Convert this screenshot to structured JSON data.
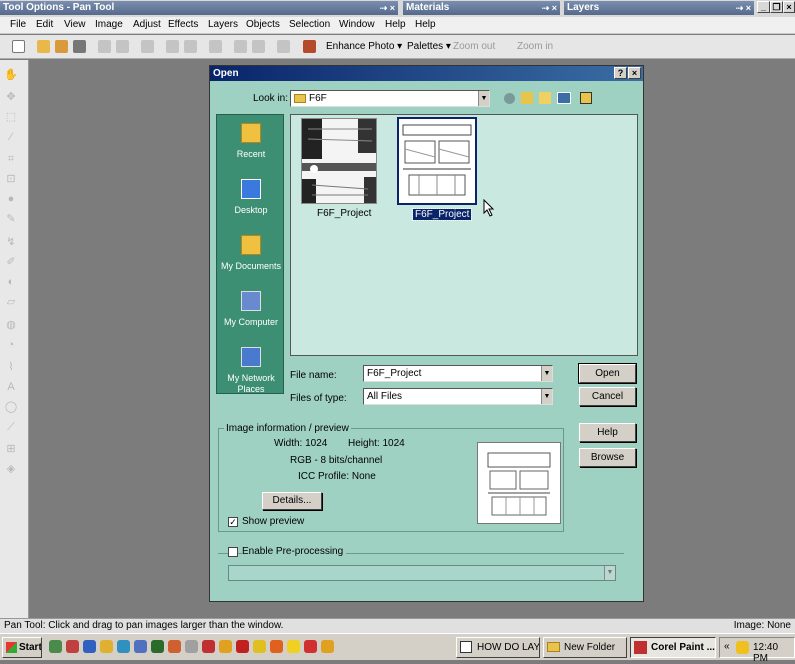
{
  "palettes": {
    "tool_options": "Tool Options - Pan Tool",
    "materials": "Materials",
    "layers": "Layers",
    "pin_close": "⇢ ×"
  },
  "menu": [
    "File",
    "Edit",
    "View",
    "Image",
    "Adjust",
    "Effects",
    "Layers",
    "Objects",
    "Selection",
    "Window",
    "Help",
    "Help"
  ],
  "toolbar": {
    "enhance_photo": "Enhance Photo ▾",
    "palettes": "Palettes ▾",
    "zoom_out": "Zoom out",
    "zoom_in": "Zoom in"
  },
  "dialog": {
    "title": "Open",
    "help_btn": "?",
    "close_btn": "×",
    "look_in_label": "Look in:",
    "look_in_value": "F6F",
    "places": [
      "Recent",
      "Desktop",
      "My Documents",
      "My Computer",
      "My Network Places"
    ],
    "files": [
      {
        "name": "F6F_Project"
      },
      {
        "name": "F6F_Project"
      }
    ],
    "file_name_label": "File name:",
    "file_name_value": "F6F_Project",
    "files_of_type_label": "Files of type:",
    "files_of_type_value": "All Files",
    "open_btn": "Open",
    "cancel_btn": "Cancel",
    "help_button": "Help",
    "browse_btn": "Browse",
    "info_group": "Image information / preview",
    "width": "Width: 1024",
    "height": "Height: 1024",
    "rgb": "RGB - 8 bits/channel",
    "icc": "ICC Profile: None",
    "details_btn": "Details...",
    "show_preview": "Show preview",
    "enable_preprocessing": "Enable Pre-processing",
    "check_mark": "✓"
  },
  "status": {
    "left": "Pan Tool: Click and drag to pan images larger than the window.",
    "right": "Image: None"
  },
  "taskbar": {
    "start": "Start",
    "tasks": [
      "HOW DO LAY...",
      "New Folder",
      "Corel Paint ..."
    ],
    "chevron": "«",
    "clock": "12:40 PM"
  },
  "colors": {
    "dialog_bg": "#9fd1c3",
    "places_bg": "#3d8f74",
    "title_active": "#0a246a",
    "list_bg": "#c8e8e0"
  }
}
